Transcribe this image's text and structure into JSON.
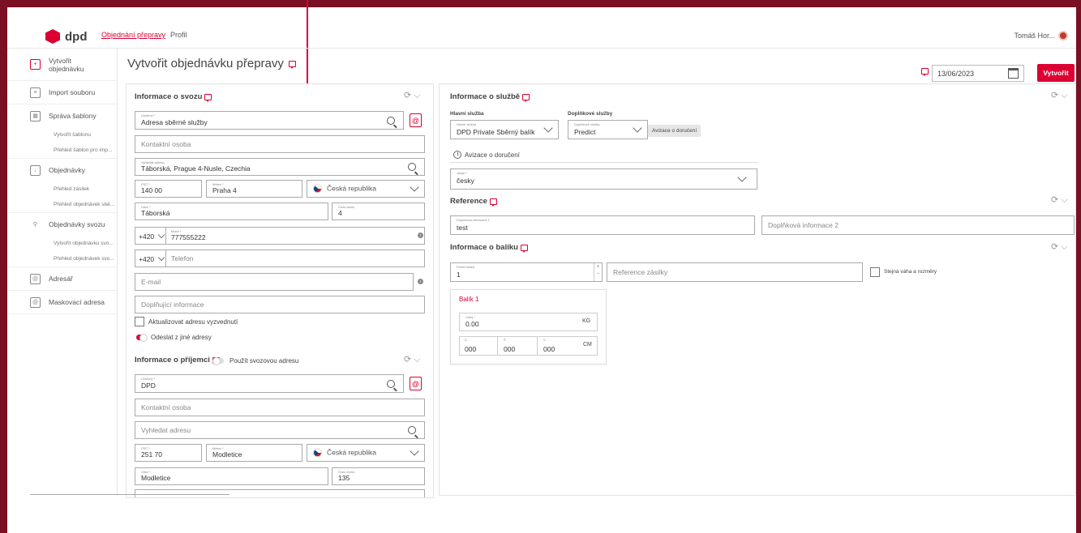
{
  "header": {
    "logo_text": "dpd",
    "nav": [
      "Objednání přepravy",
      "Profil"
    ],
    "user": "Tomáš Hor..."
  },
  "sidebar": {
    "items": [
      {
        "label": "Vytvořit objednávku",
        "icon": "create-order-icon"
      },
      {
        "label": "Import souboru",
        "icon": "import-icon"
      },
      {
        "label": "Správa šablony",
        "icon": "template-icon",
        "subs": [
          "Vytvořit šablonu",
          "Přehled šablon pro imp..."
        ]
      },
      {
        "label": "Objednávky",
        "icon": "orders-icon",
        "subs": [
          "Přehled zásilek",
          "Přehled objednávek sbě..."
        ]
      },
      {
        "label": "Objednávky svozu",
        "icon": "pickup-icon",
        "subs": [
          "Vytvořit objednávku svo...",
          "Přehled objednávek svo..."
        ]
      },
      {
        "label": "Adresář",
        "icon": "addressbook-icon"
      },
      {
        "label": "Maskovací adresa",
        "icon": "mask-address-icon"
      }
    ]
  },
  "main": {
    "title": "Vytvořit objednávku přepravy",
    "date": "13/06/2023",
    "create_button": "Vytvořit"
  },
  "pickup": {
    "title": "Informace o svozu",
    "address_label": "Uložený *",
    "address_value": "Adresa sběrné služby",
    "contact_placeholder": "Kontaktní osoba",
    "search_label": "Vyhledat adresu",
    "search_value": "Táborská, Prague 4-Nusle, Czechia",
    "zip_label": "PSČ *",
    "zip": "140 00",
    "city_label": "Město *",
    "city": "Praha 4",
    "country": "Česká republika",
    "street_label": "Ulice *",
    "street": "Táborská",
    "number_label": "Číslo domu",
    "number": "4",
    "phone_prefix": "+420",
    "mobile_label": "Mobil *",
    "mobile": "777555222",
    "phone_placeholder": "Telefon",
    "email_placeholder": "E-mail",
    "extra_placeholder": "Doplňující informace",
    "update_checkbox": "Aktualizovat adresu vyzvednutí",
    "send_other": "Odeslat z jiné adresy"
  },
  "recipient": {
    "title": "Informace o příjemci",
    "use_pickup": "Použít svozovou adresu",
    "address_label": "Uložený *",
    "address_value": "DPD",
    "contact_placeholder": "Kontaktní osoba",
    "search_placeholder": "Vyhledat adresu",
    "zip_label": "PSČ *",
    "zip": "251 70",
    "city_label": "Město *",
    "city": "Modletice",
    "country": "Česká republika",
    "street_label": "Ulice *",
    "street": "Modletice",
    "number_label": "Číslo domu",
    "number": "135"
  },
  "service": {
    "title": "Informace o službě",
    "main_label": "Hlavní služba",
    "main_field_label": "Hlavní služba",
    "main_value": "DPD Private Sběrný balík",
    "extra_label": "Doplňkové služby",
    "extra_field_label": "Doplňkové služby",
    "extra_value": "Predict",
    "notify_button": "Avizace o doručení",
    "notify_section": "Avizace o doručení",
    "lang_label": "Jazyk *",
    "lang_value": "česky"
  },
  "reference": {
    "title": "Reference",
    "info1_label": "Doplňková informace 1",
    "info1_value": "test",
    "info2_placeholder": "Doplňková informace 2"
  },
  "package": {
    "title": "Informace o balíku",
    "count_label": "Počet balíků",
    "count": "1",
    "ref_placeholder": "Reference zásilky",
    "same_weight": "Stejná váha a rozměry",
    "box_title": "Balík 1",
    "weight_label": "Váha *",
    "weight": "0.00",
    "weight_unit": "KG",
    "dim_labels": [
      "D",
      "Š",
      "V"
    ],
    "dims": [
      "000",
      "000",
      "000"
    ],
    "dim_unit": "CM"
  },
  "colors": {
    "accent": "#dc0032",
    "frame": "#7a1023"
  }
}
